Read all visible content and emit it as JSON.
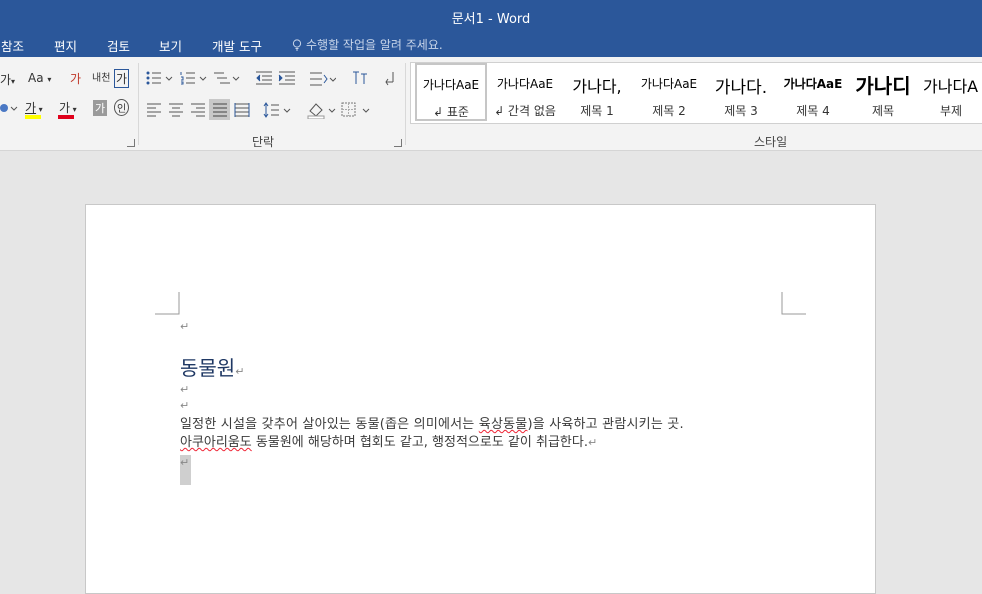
{
  "window": {
    "title": "문서1 - Word"
  },
  "menu": {
    "tabs": [
      "참조",
      "편지",
      "검토",
      "보기",
      "개발 도구"
    ],
    "tell_me": "수행할 작업을 알려 주세요."
  },
  "ribbon": {
    "font_group": {
      "font_char": "가",
      "change_case": "Aa",
      "phonetic": "내천",
      "enclose": "가",
      "highlight_char": "가",
      "color_char": "가",
      "shade_char": "가",
      "circle_char": "인"
    },
    "paragraph_label": "단락",
    "styles_label": "스타일",
    "styles": [
      {
        "preview": "가나다AaE",
        "name": "↲ 표준"
      },
      {
        "preview": "가나다AaE",
        "name": "↲ 간격 없음"
      },
      {
        "preview": "가나다,",
        "name": "제목 1"
      },
      {
        "preview": "가나다AaE",
        "name": "제목 2"
      },
      {
        "preview": "가나다.",
        "name": "제목 3"
      },
      {
        "preview": "가나다AaE",
        "name": "제목 4"
      },
      {
        "preview": "가나디",
        "name": "제목"
      },
      {
        "preview": "가나다A",
        "name": "부제"
      }
    ]
  },
  "document": {
    "para_mark": "↵",
    "heading": "동물원",
    "body_line1_a": "일정한 시설을 갖추어 살아있는 동물(좁은 의미에서는 ",
    "body_line1_sq": "육상동물",
    "body_line1_b": ")을 사육하고 관람시키는 곳.",
    "body_line2_sq": "아쿠아리움도",
    "body_line2_b": " 동물원에 해당하며 협회도 같고, 행정적으로도 같이 취급한다.",
    "colors": {
      "title_bar": "#2b579a",
      "heading": "#1f3864"
    }
  }
}
